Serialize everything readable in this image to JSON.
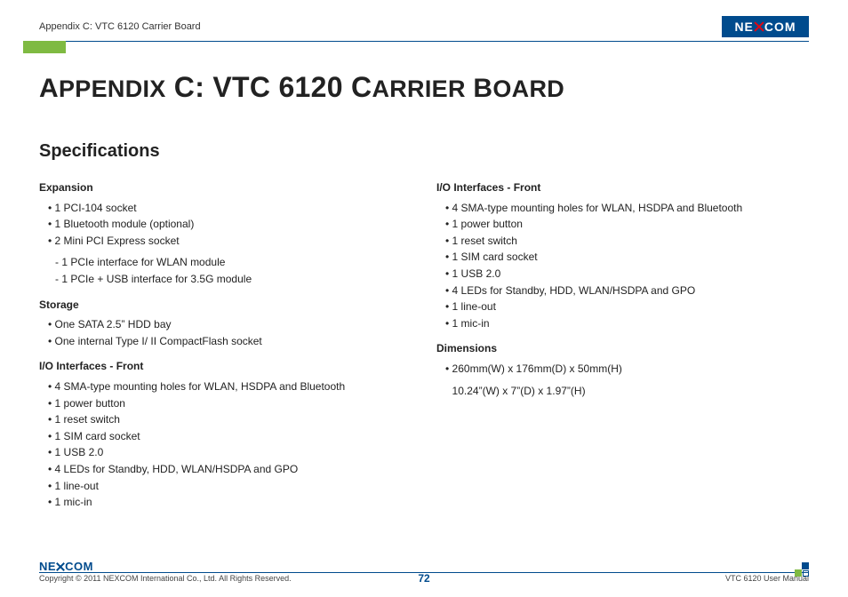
{
  "brand": {
    "name": "NEXCOM"
  },
  "header": {
    "breadcrumb": "Appendix C: VTC 6120 Carrier Board"
  },
  "title": {
    "html_parts": [
      "A",
      "PPENDIX",
      " C: VTC 6120 C",
      "ARRIER",
      " B",
      "OARD"
    ],
    "plain": "Appendix C: VTC 6120 Carrier Board"
  },
  "section_heading": "Specifications",
  "left": {
    "g1": {
      "title": "Expansion",
      "items": [
        "1 PCI-104 socket",
        "1 Bluetooth module (optional)",
        "2 Mini PCI Express socket"
      ],
      "sub": [
        "1 PCIe interface for WLAN module",
        "1 PCIe + USB interface for 3.5G module"
      ]
    },
    "g2": {
      "title": "Storage",
      "items": [
        "One SATA 2.5” HDD bay",
        "One internal Type I/ II CompactFlash socket"
      ]
    },
    "g3": {
      "title": "I/O Interfaces - Front",
      "items": [
        "4 SMA-type mounting holes for WLAN, HSDPA and Bluetooth",
        "1 power button",
        "1 reset switch",
        "1 SIM card socket",
        "1 USB 2.0",
        "4 LEDs for Standby, HDD, WLAN/HSDPA and GPO",
        "1 line-out",
        "1 mic-in"
      ]
    }
  },
  "right": {
    "g1": {
      "title": "I/O Interfaces - Front",
      "items": [
        "4 SMA-type mounting holes for WLAN, HSDPA and Bluetooth",
        "1 power button",
        "1 reset switch",
        "1 SIM card socket",
        "1 USB 2.0",
        "4 LEDs for Standby, HDD, WLAN/HSDPA and GPO",
        "1 line-out",
        "1 mic-in"
      ]
    },
    "g2": {
      "title": "Dimensions",
      "items": [
        "260mm(W) x 176mm(D) x 50mm(H)",
        "10.24”(W) x 7”(D) x 1.97”(H)"
      ]
    }
  },
  "footer": {
    "copyright": "Copyright © 2011 NEXCOM International Co., Ltd. All Rights Reserved.",
    "page": "72",
    "manual": "VTC 6120 User Manual"
  }
}
